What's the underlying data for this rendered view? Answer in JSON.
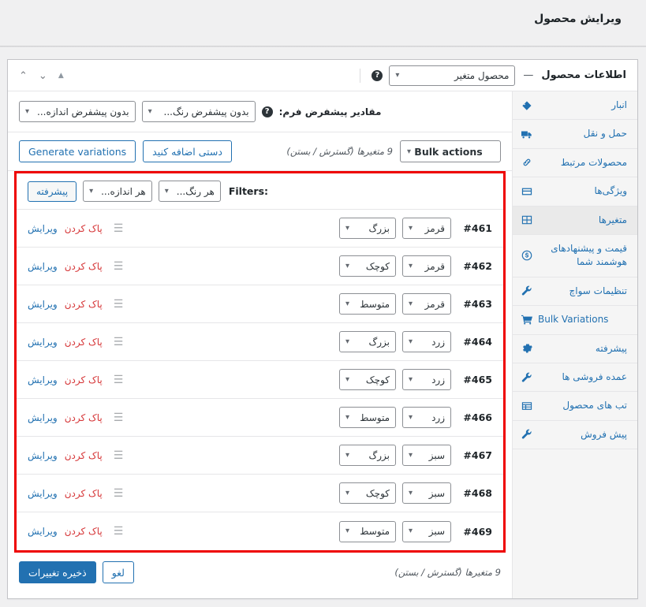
{
  "page": {
    "title": "ویرایش محصول"
  },
  "product_box": {
    "title": "اطلاعات محصول",
    "dash": "—",
    "product_type": "محصول متغیر",
    "help_icon": "question-mark-icon",
    "handle_icons": [
      "sort-handle-icon",
      "chevron-down-icon",
      "chevron-up-icon"
    ]
  },
  "tabs": [
    {
      "label": "انبار",
      "icon": "tag-icon",
      "active": false,
      "ltr": false
    },
    {
      "label": "حمل و نقل",
      "icon": "truck-icon",
      "active": false,
      "ltr": false
    },
    {
      "label": "محصولات مرتبط",
      "icon": "link-icon",
      "active": false,
      "ltr": false
    },
    {
      "label": "ویژگی‌ها",
      "icon": "attributes-icon",
      "active": false,
      "ltr": false
    },
    {
      "label": "متغیرها",
      "icon": "grid-icon",
      "active": true,
      "ltr": false
    },
    {
      "label": "قیمت و پیشنهادهای هوشمند شما",
      "icon": "dollar-icon",
      "active": false,
      "ltr": false
    },
    {
      "label": "تنظیمات سواچ",
      "icon": "wrench-icon",
      "active": false,
      "ltr": false
    },
    {
      "label": "Bulk Variations",
      "icon": "cart-icon",
      "active": false,
      "ltr": true
    },
    {
      "label": "پیشرفته",
      "icon": "gear-icon",
      "active": false,
      "ltr": false
    },
    {
      "label": "عمده فروشی ها",
      "icon": "wrench-icon",
      "active": false,
      "ltr": false
    },
    {
      "label": "تب های محصول",
      "icon": "table-icon",
      "active": false,
      "ltr": false
    },
    {
      "label": "پیش فروش",
      "icon": "wrench-icon",
      "active": false,
      "ltr": false
    }
  ],
  "defaults": {
    "label": "مقادیر پیشفرض فرم:",
    "help_icon": "question-mark-icon",
    "color_select": "بدون پیشفرض رنگ...",
    "size_select": "بدون پیشفرض اندازه..."
  },
  "toolbar": {
    "generate_label": "Generate variations",
    "add_manually_label": "دستی اضافه کنید",
    "variation_count": "9 متغیرها (گسترش / بستن)",
    "bulk_actions_label": "Bulk actions"
  },
  "filters": {
    "label": "Filters:",
    "color_any": "هر رنگ...",
    "size_any": "هر اندازه...",
    "advanced_label": "پیشرفته"
  },
  "rows_actions": {
    "edit_label": "ویرایش",
    "remove_label": "پاک کردن",
    "drag_icon": "drag-handle-icon"
  },
  "variations": [
    {
      "id": "#461",
      "color": "قرمز",
      "size": "بزرگ"
    },
    {
      "id": "#462",
      "color": "قرمز",
      "size": "کوچک"
    },
    {
      "id": "#463",
      "color": "قرمز",
      "size": "متوسط"
    },
    {
      "id": "#464",
      "color": "زرد",
      "size": "بزرگ"
    },
    {
      "id": "#465",
      "color": "زرد",
      "size": "کوچک"
    },
    {
      "id": "#466",
      "color": "زرد",
      "size": "متوسط"
    },
    {
      "id": "#467",
      "color": "سبز",
      "size": "بزرگ"
    },
    {
      "id": "#468",
      "color": "سبز",
      "size": "کوچک"
    },
    {
      "id": "#469",
      "color": "سبز",
      "size": "متوسط"
    }
  ],
  "footer": {
    "save_label": "ذخیره تغییرات",
    "cancel_label": "لغو",
    "variation_count": "9 متغیرها (گسترش / بستن)"
  },
  "colors": {
    "accent_blue": "#2271b1",
    "danger_red": "#d63638",
    "highlight_red": "#ee0000",
    "text_dark": "#1d2327",
    "panel_bg": "#f5f5f5"
  }
}
